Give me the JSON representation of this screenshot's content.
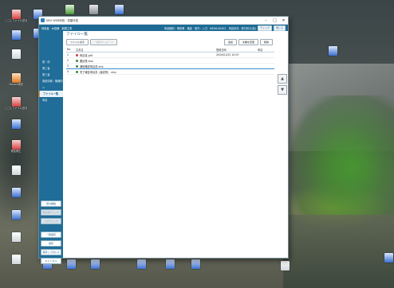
{
  "desktop": {
    "icons": [
      {
        "id": "d1",
        "label": "ここにファイル送る",
        "icon": "pdf-file-icon",
        "color": "red"
      },
      {
        "id": "d2",
        "label": "",
        "icon": "app-icon",
        "color": "blue"
      },
      {
        "id": "d3",
        "label": "",
        "icon": "document-icon",
        "color": "white"
      },
      {
        "id": "d4",
        "label": "Docsin地図",
        "icon": "folder-icon",
        "color": "orange"
      },
      {
        "id": "d5",
        "label": "ここにファイル送る",
        "icon": "pdf-file-icon",
        "color": "red"
      },
      {
        "id": "d6",
        "label": "",
        "icon": "app-icon",
        "color": "blue"
      },
      {
        "id": "d7",
        "label": "緊急修正",
        "icon": "pdf-file-icon",
        "color": "red"
      },
      {
        "id": "d8",
        "label": "",
        "icon": "document-icon",
        "color": "white"
      },
      {
        "id": "d9",
        "label": "",
        "icon": "app-icon",
        "color": "blue"
      },
      {
        "id": "d10",
        "label": "",
        "icon": "app-icon",
        "color": "blue"
      },
      {
        "id": "d11",
        "label": "",
        "icon": "document-icon",
        "color": "white"
      },
      {
        "id": "d12",
        "label": "",
        "icon": "document-icon",
        "color": "white"
      },
      {
        "id": "d13",
        "label": "",
        "icon": "app-icon",
        "color": "blue"
      },
      {
        "id": "d14",
        "label": "",
        "icon": "app-icon",
        "color": "blue"
      },
      {
        "id": "d15",
        "label": "",
        "icon": "app-icon",
        "color": "green"
      },
      {
        "id": "d16",
        "label": "",
        "icon": "app-icon",
        "color": "gray"
      },
      {
        "id": "d17",
        "label": "",
        "icon": "app-icon",
        "color": "blue"
      },
      {
        "id": "d18",
        "label": "",
        "icon": "app-icon",
        "color": "blue"
      },
      {
        "id": "d19",
        "label": "",
        "icon": "document-icon",
        "color": "white"
      },
      {
        "id": "d20",
        "label": "",
        "icon": "app-icon",
        "color": "blue"
      },
      {
        "id": "d21",
        "label": "",
        "icon": "app-icon",
        "color": "blue"
      },
      {
        "id": "d22",
        "label": "",
        "icon": "app-icon",
        "color": "blue"
      },
      {
        "id": "d23",
        "label": "",
        "icon": "app-icon",
        "color": "blue"
      },
      {
        "id": "d24",
        "label": "",
        "icon": "app-icon",
        "color": "blue"
      },
      {
        "id": "d25",
        "label": "",
        "icon": "app-icon",
        "color": "blue"
      },
      {
        "id": "d26",
        "label": "",
        "icon": "app-icon",
        "color": "blue"
      }
    ]
  },
  "window": {
    "title": "NEO WEB申請・書類作成",
    "controls": {
      "minimize": "–",
      "maximize": "□",
      "close": "✕"
    },
    "header": {
      "left": "利用者：木田様　新規工事",
      "right": "申請種別：電気等　施設　受付：入力　NEO6-00001　申請状況：受付待ち(仮)",
      "button1": "チェック",
      "button2": "閉じる"
    },
    "sidebar": {
      "items": [
        "基・情",
        "第三者",
        "第三者",
        "施設情報・機器情報",
        "○",
        "ファイル一覧",
        "申請"
      ],
      "active_index": 5,
      "buttons": [
        {
          "label": "受付開始",
          "disabled": false
        },
        {
          "label": "受付前チェック",
          "disabled": true
        },
        {
          "label": "入力チェック",
          "disabled": true
        },
        {
          "label": "一時保存",
          "disabled": false
        },
        {
          "label": "保存",
          "disabled": false
        },
        {
          "label": "保存して閉じる",
          "disabled": false
        },
        {
          "label": "キャンセル",
          "disabled": false
        }
      ]
    },
    "main": {
      "page_title": "ファイル一覧",
      "toolbar": {
        "show_file": "ファイル表示",
        "bulk_download": "一括ダウンロード",
        "add": "追加",
        "replace": "文書を変更",
        "delete": "削除"
      },
      "table": {
        "columns": [
          "No",
          "文書名",
          "登録日時",
          "申請"
        ],
        "rows": [
          {
            "no": "1",
            "name": "申請書.pdf",
            "type": "pdf",
            "date": "2020/01/22 10:07",
            "status": ""
          },
          {
            "no": "2",
            "name": "要目表.xlsx",
            "type": "xls",
            "date": "",
            "status": ""
          },
          {
            "no": "3",
            "name": "通知確認申請書.xlsx",
            "type": "xls",
            "date": "",
            "status": ""
          },
          {
            "no": "4",
            "name": "完了報告申請書（届書別）.xlsx",
            "type": "xls",
            "date": "",
            "status": ""
          }
        ],
        "selected_index": 2
      },
      "side_buttons": {
        "up": "▲",
        "down": "▼"
      }
    }
  }
}
